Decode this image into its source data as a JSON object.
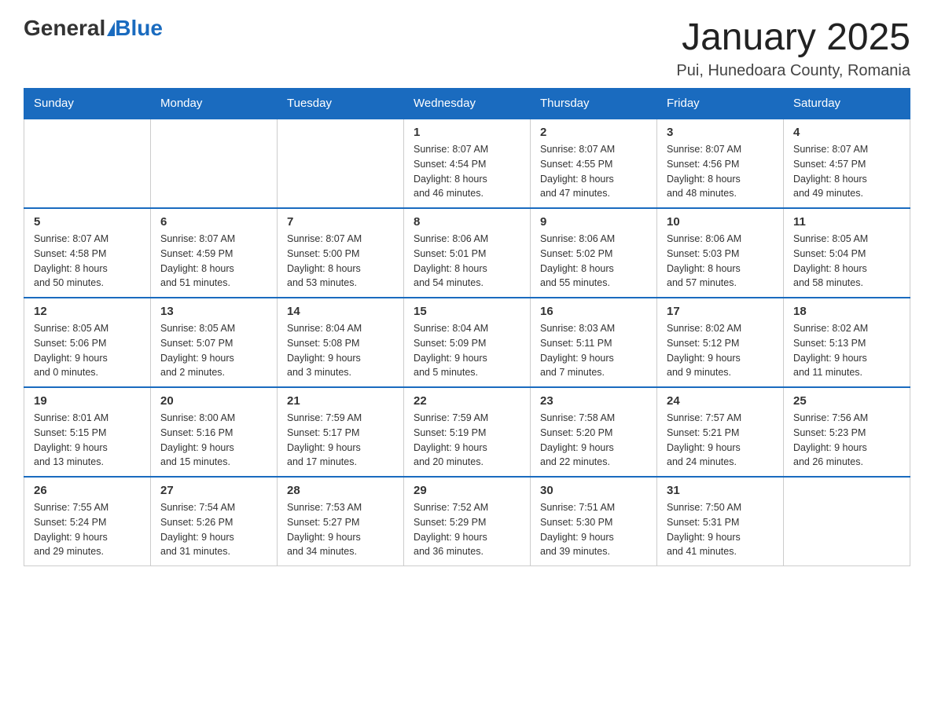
{
  "logo": {
    "general": "General",
    "blue": "Blue"
  },
  "title": "January 2025",
  "location": "Pui, Hunedoara County, Romania",
  "days_of_week": [
    "Sunday",
    "Monday",
    "Tuesday",
    "Wednesday",
    "Thursday",
    "Friday",
    "Saturday"
  ],
  "weeks": [
    [
      {
        "day": "",
        "info": ""
      },
      {
        "day": "",
        "info": ""
      },
      {
        "day": "",
        "info": ""
      },
      {
        "day": "1",
        "info": "Sunrise: 8:07 AM\nSunset: 4:54 PM\nDaylight: 8 hours\nand 46 minutes."
      },
      {
        "day": "2",
        "info": "Sunrise: 8:07 AM\nSunset: 4:55 PM\nDaylight: 8 hours\nand 47 minutes."
      },
      {
        "day": "3",
        "info": "Sunrise: 8:07 AM\nSunset: 4:56 PM\nDaylight: 8 hours\nand 48 minutes."
      },
      {
        "day": "4",
        "info": "Sunrise: 8:07 AM\nSunset: 4:57 PM\nDaylight: 8 hours\nand 49 minutes."
      }
    ],
    [
      {
        "day": "5",
        "info": "Sunrise: 8:07 AM\nSunset: 4:58 PM\nDaylight: 8 hours\nand 50 minutes."
      },
      {
        "day": "6",
        "info": "Sunrise: 8:07 AM\nSunset: 4:59 PM\nDaylight: 8 hours\nand 51 minutes."
      },
      {
        "day": "7",
        "info": "Sunrise: 8:07 AM\nSunset: 5:00 PM\nDaylight: 8 hours\nand 53 minutes."
      },
      {
        "day": "8",
        "info": "Sunrise: 8:06 AM\nSunset: 5:01 PM\nDaylight: 8 hours\nand 54 minutes."
      },
      {
        "day": "9",
        "info": "Sunrise: 8:06 AM\nSunset: 5:02 PM\nDaylight: 8 hours\nand 55 minutes."
      },
      {
        "day": "10",
        "info": "Sunrise: 8:06 AM\nSunset: 5:03 PM\nDaylight: 8 hours\nand 57 minutes."
      },
      {
        "day": "11",
        "info": "Sunrise: 8:05 AM\nSunset: 5:04 PM\nDaylight: 8 hours\nand 58 minutes."
      }
    ],
    [
      {
        "day": "12",
        "info": "Sunrise: 8:05 AM\nSunset: 5:06 PM\nDaylight: 9 hours\nand 0 minutes."
      },
      {
        "day": "13",
        "info": "Sunrise: 8:05 AM\nSunset: 5:07 PM\nDaylight: 9 hours\nand 2 minutes."
      },
      {
        "day": "14",
        "info": "Sunrise: 8:04 AM\nSunset: 5:08 PM\nDaylight: 9 hours\nand 3 minutes."
      },
      {
        "day": "15",
        "info": "Sunrise: 8:04 AM\nSunset: 5:09 PM\nDaylight: 9 hours\nand 5 minutes."
      },
      {
        "day": "16",
        "info": "Sunrise: 8:03 AM\nSunset: 5:11 PM\nDaylight: 9 hours\nand 7 minutes."
      },
      {
        "day": "17",
        "info": "Sunrise: 8:02 AM\nSunset: 5:12 PM\nDaylight: 9 hours\nand 9 minutes."
      },
      {
        "day": "18",
        "info": "Sunrise: 8:02 AM\nSunset: 5:13 PM\nDaylight: 9 hours\nand 11 minutes."
      }
    ],
    [
      {
        "day": "19",
        "info": "Sunrise: 8:01 AM\nSunset: 5:15 PM\nDaylight: 9 hours\nand 13 minutes."
      },
      {
        "day": "20",
        "info": "Sunrise: 8:00 AM\nSunset: 5:16 PM\nDaylight: 9 hours\nand 15 minutes."
      },
      {
        "day": "21",
        "info": "Sunrise: 7:59 AM\nSunset: 5:17 PM\nDaylight: 9 hours\nand 17 minutes."
      },
      {
        "day": "22",
        "info": "Sunrise: 7:59 AM\nSunset: 5:19 PM\nDaylight: 9 hours\nand 20 minutes."
      },
      {
        "day": "23",
        "info": "Sunrise: 7:58 AM\nSunset: 5:20 PM\nDaylight: 9 hours\nand 22 minutes."
      },
      {
        "day": "24",
        "info": "Sunrise: 7:57 AM\nSunset: 5:21 PM\nDaylight: 9 hours\nand 24 minutes."
      },
      {
        "day": "25",
        "info": "Sunrise: 7:56 AM\nSunset: 5:23 PM\nDaylight: 9 hours\nand 26 minutes."
      }
    ],
    [
      {
        "day": "26",
        "info": "Sunrise: 7:55 AM\nSunset: 5:24 PM\nDaylight: 9 hours\nand 29 minutes."
      },
      {
        "day": "27",
        "info": "Sunrise: 7:54 AM\nSunset: 5:26 PM\nDaylight: 9 hours\nand 31 minutes."
      },
      {
        "day": "28",
        "info": "Sunrise: 7:53 AM\nSunset: 5:27 PM\nDaylight: 9 hours\nand 34 minutes."
      },
      {
        "day": "29",
        "info": "Sunrise: 7:52 AM\nSunset: 5:29 PM\nDaylight: 9 hours\nand 36 minutes."
      },
      {
        "day": "30",
        "info": "Sunrise: 7:51 AM\nSunset: 5:30 PM\nDaylight: 9 hours\nand 39 minutes."
      },
      {
        "day": "31",
        "info": "Sunrise: 7:50 AM\nSunset: 5:31 PM\nDaylight: 9 hours\nand 41 minutes."
      },
      {
        "day": "",
        "info": ""
      }
    ]
  ]
}
